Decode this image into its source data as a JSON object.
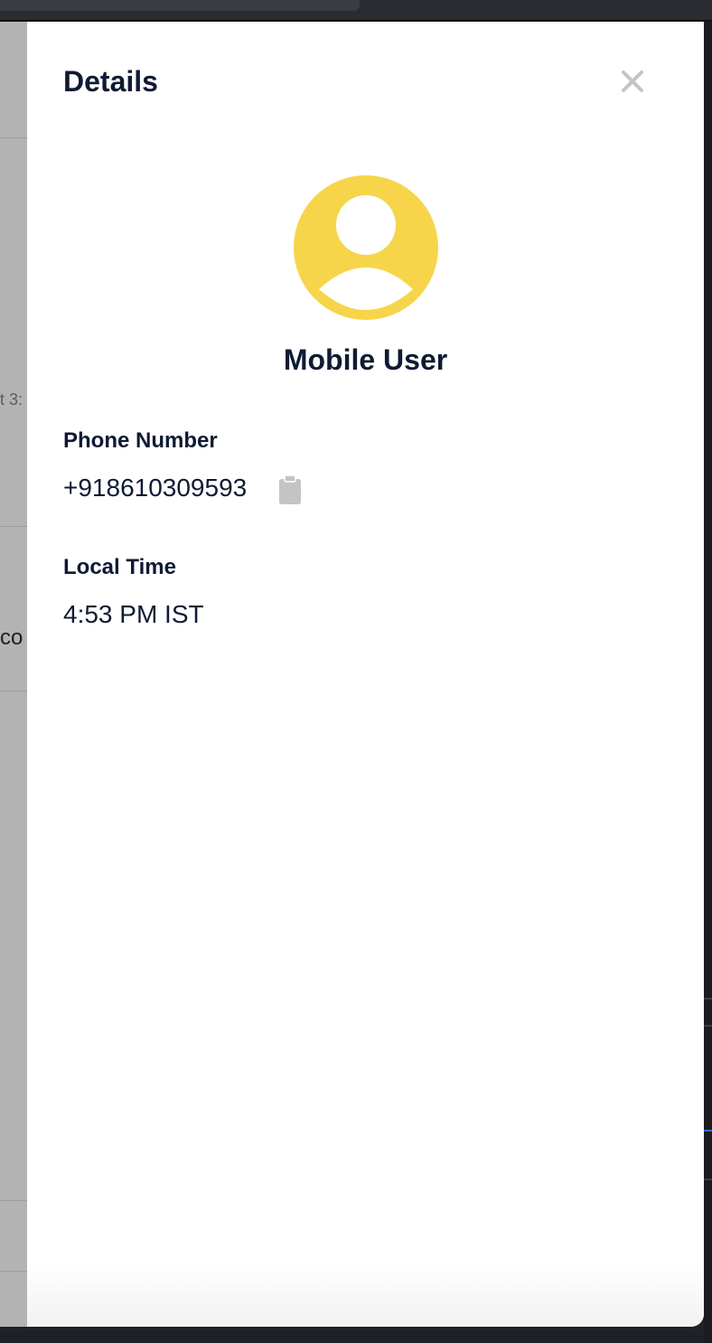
{
  "background": {
    "fragment_1": "t 3:",
    "fragment_2": "co"
  },
  "panel": {
    "title": "Details",
    "close_icon": "close-icon",
    "avatar_icon": "user-avatar-icon",
    "avatar_color": "#f7d54a",
    "user_name": "Mobile User",
    "phone_label": "Phone Number",
    "phone_value": "+918610309593",
    "copy_icon": "clipboard-icon",
    "time_label": "Local Time",
    "time_value": "4:53 PM IST"
  },
  "colors": {
    "text_primary": "#0f1a33",
    "icon_gray": "#c4c4c4"
  }
}
